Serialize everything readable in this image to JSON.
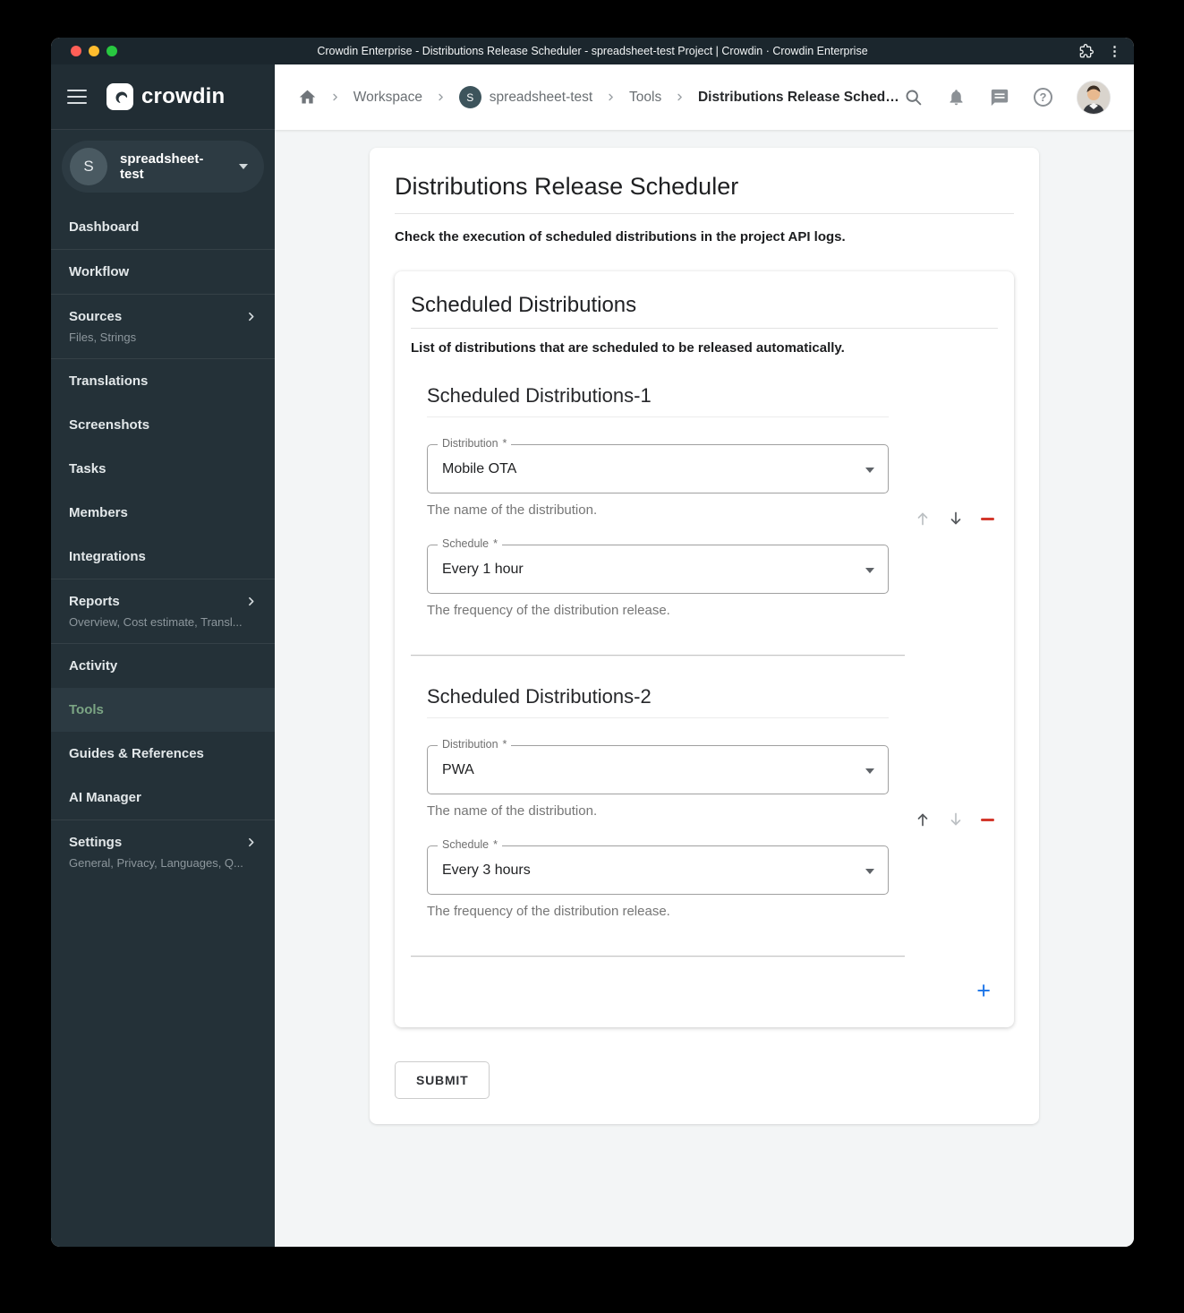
{
  "titlebar": {
    "title": "Crowdin Enterprise - Distributions Release Scheduler - spreadsheet-test Project | Crowdin · Crowdin Enterprise"
  },
  "brand": {
    "name": "crowdin"
  },
  "sidebar": {
    "project": {
      "initial": "S",
      "name": "spreadsheet-test"
    },
    "items": [
      {
        "label": "Dashboard"
      },
      {
        "label": "Workflow"
      },
      {
        "label": "Sources",
        "sublabel": "Files, Strings"
      },
      {
        "label": "Translations"
      },
      {
        "label": "Screenshots"
      },
      {
        "label": "Tasks"
      },
      {
        "label": "Members"
      },
      {
        "label": "Integrations"
      },
      {
        "label": "Reports",
        "sublabel": "Overview, Cost estimate, Transl..."
      },
      {
        "label": "Activity"
      },
      {
        "label": "Tools"
      },
      {
        "label": "Guides & References"
      },
      {
        "label": "AI Manager"
      },
      {
        "label": "Settings",
        "sublabel": "General, Privacy, Languages, Q..."
      }
    ]
  },
  "breadcrumb": {
    "items": [
      {
        "label": "Workspace"
      },
      {
        "label": "spreadsheet-test",
        "initial": "S"
      },
      {
        "label": "Tools"
      },
      {
        "label": "Distributions Release Schedul..."
      }
    ]
  },
  "page": {
    "title": "Distributions Release Scheduler",
    "subtitle": "Check the execution of scheduled distributions in the project API logs."
  },
  "panel": {
    "title": "Scheduled Distributions",
    "subtitle": "List of distributions that are scheduled to be released automatically."
  },
  "form": {
    "required_mark": "*",
    "groups": [
      {
        "title": "Scheduled Distributions-1",
        "distribution": {
          "label": "Distribution",
          "value": "Mobile OTA",
          "helper": "The name of the distribution."
        },
        "schedule": {
          "label": "Schedule",
          "value": "Every 1 hour",
          "helper": "The frequency of the distribution release."
        }
      },
      {
        "title": "Scheduled Distributions-2",
        "distribution": {
          "label": "Distribution",
          "value": "PWA",
          "helper": "The name of the distribution."
        },
        "schedule": {
          "label": "Schedule",
          "value": "Every 3 hours",
          "helper": "The frequency of the distribution release."
        }
      }
    ],
    "add_label": "+",
    "submit_label": "SUBMIT"
  },
  "icons": {
    "plus": "+",
    "question_mark": "?",
    "ellipsis_vertical": "⋮"
  },
  "colors": {
    "accent_green": "#7ba584",
    "danger_red": "#d3382c",
    "primary_blue": "#1a73e8",
    "traffic_red": "#ff5f57",
    "traffic_yellow": "#febc2e",
    "traffic_green": "#28c840"
  }
}
